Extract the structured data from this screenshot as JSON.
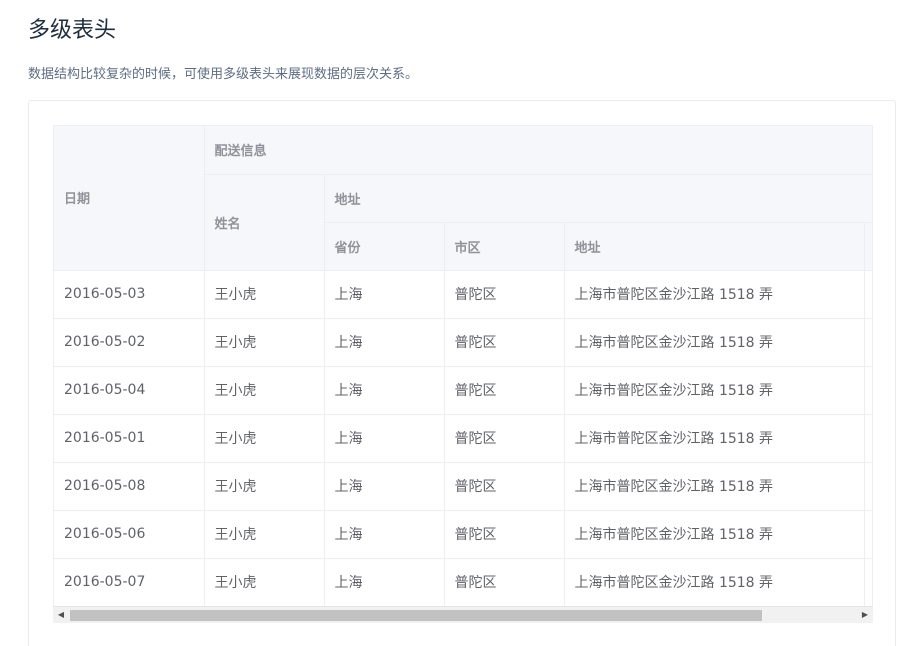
{
  "page": {
    "title": "多级表头",
    "description": "数据结构比较复杂的时候，可使用多级表头来展现数据的层次关系。"
  },
  "table": {
    "headers": {
      "date": "日期",
      "delivery_info": "配送信息",
      "name": "姓名",
      "address_group": "地址",
      "province": "省份",
      "city": "市区",
      "address": "地址"
    },
    "rows": [
      {
        "date": "2016-05-03",
        "name": "王小虎",
        "province": "上海",
        "city": "普陀区",
        "address": "上海市普陀区金沙江路 1518 弄"
      },
      {
        "date": "2016-05-02",
        "name": "王小虎",
        "province": "上海",
        "city": "普陀区",
        "address": "上海市普陀区金沙江路 1518 弄"
      },
      {
        "date": "2016-05-04",
        "name": "王小虎",
        "province": "上海",
        "city": "普陀区",
        "address": "上海市普陀区金沙江路 1518 弄"
      },
      {
        "date": "2016-05-01",
        "name": "王小虎",
        "province": "上海",
        "city": "普陀区",
        "address": "上海市普陀区金沙江路 1518 弄"
      },
      {
        "date": "2016-05-08",
        "name": "王小虎",
        "province": "上海",
        "city": "普陀区",
        "address": "上海市普陀区金沙江路 1518 弄"
      },
      {
        "date": "2016-05-06",
        "name": "王小虎",
        "province": "上海",
        "city": "普陀区",
        "address": "上海市普陀区金沙江路 1518 弄"
      },
      {
        "date": "2016-05-07",
        "name": "王小虎",
        "province": "上海",
        "city": "普陀区",
        "address": "上海市普陀区金沙江路 1518 弄"
      }
    ]
  },
  "scrollbar": {
    "left_arrow": "◀",
    "right_arrow": "▶"
  },
  "colors": {
    "header_bg": "#f5f7fa",
    "border": "#ebeef5",
    "header_text": "#909399",
    "cell_text": "#606266"
  }
}
